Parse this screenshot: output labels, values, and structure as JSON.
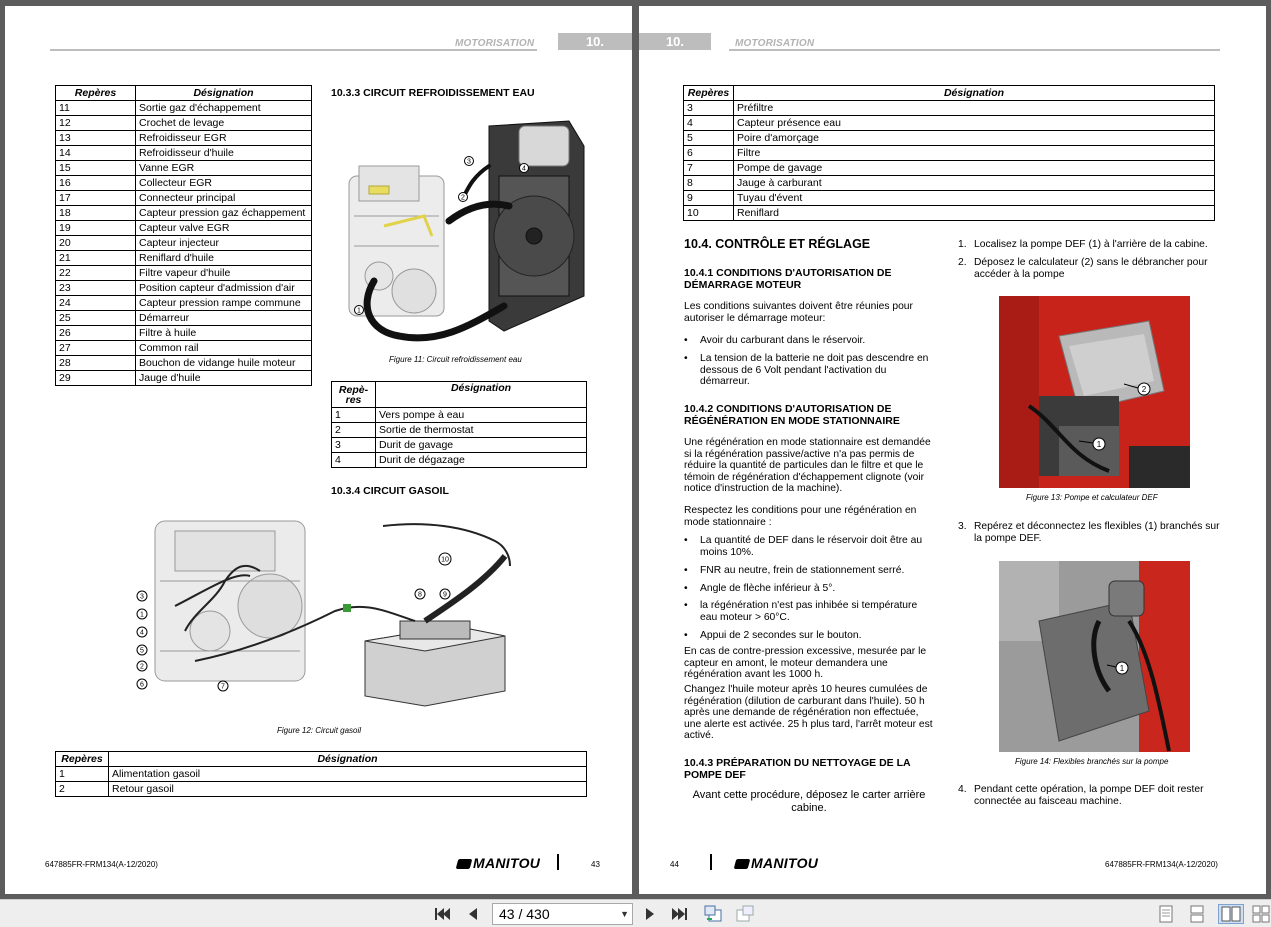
{
  "left_page": {
    "header_title": "MOTORISATION",
    "header_num": "10.",
    "table1": {
      "headers": [
        "Repères",
        "Désignation"
      ],
      "rows": [
        [
          "11",
          "Sortie gaz d'échappement"
        ],
        [
          "12",
          "Crochet de levage"
        ],
        [
          "13",
          "Refroidisseur EGR"
        ],
        [
          "14",
          "Refroidisseur d'huile"
        ],
        [
          "15",
          "Vanne EGR"
        ],
        [
          "16",
          "Collecteur EGR"
        ],
        [
          "17",
          "Connecteur principal"
        ],
        [
          "18",
          "Capteur pression gaz échappement"
        ],
        [
          "19",
          "Capteur valve EGR"
        ],
        [
          "20",
          "Capteur injecteur"
        ],
        [
          "21",
          "Reniflard d'huile"
        ],
        [
          "22",
          "Filtre vapeur d'huile"
        ],
        [
          "23",
          "Position capteur d'admission d'air"
        ],
        [
          "24",
          "Capteur pression rampe commune"
        ],
        [
          "25",
          "Démarreur"
        ],
        [
          "26",
          "Filtre à huile"
        ],
        [
          "27",
          "Common rail"
        ],
        [
          "28",
          "Bouchon de vidange huile moteur"
        ],
        [
          "29",
          "Jauge d'huile"
        ]
      ]
    },
    "section_1033": "10.3.3 CIRCUIT REFROIDISSEMENT EAU",
    "fig11_caption": "Figure 11: Circuit refroidissement eau",
    "fig11_callouts": [
      "1",
      "2",
      "3",
      "4"
    ],
    "table2": {
      "headers": [
        "Repè-res",
        "Désignation"
      ],
      "rows": [
        [
          "1",
          "Vers pompe à eau"
        ],
        [
          "2",
          "Sortie de thermostat"
        ],
        [
          "3",
          "Durit de gavage"
        ],
        [
          "4",
          "Durit de dégazage"
        ]
      ]
    },
    "section_1034": "10.3.4 CIRCUIT GASOIL",
    "fig12_caption": "Figure 12: Circuit gasoil",
    "fig12_callouts": [
      "3",
      "1",
      "4",
      "5",
      "2",
      "6",
      "7",
      "8",
      "9",
      "10"
    ],
    "table3": {
      "headers": [
        "Repères",
        "Désignation"
      ],
      "rows": [
        [
          "1",
          "Alimentation gasoil"
        ],
        [
          "2",
          "Retour gasoil"
        ]
      ]
    },
    "footer_code": "647885FR-FRM134(A-12/2020)",
    "page_number": "43",
    "logo": "MANITOU"
  },
  "right_page": {
    "header_title": "MOTORISATION",
    "header_num": "10.",
    "table1": {
      "headers": [
        "Repères",
        "Désignation"
      ],
      "rows": [
        [
          "3",
          "Préfiltre"
        ],
        [
          "4",
          "Capteur présence eau"
        ],
        [
          "5",
          "Poire d'amorçage"
        ],
        [
          "6",
          "Filtre"
        ],
        [
          "7",
          "Pompe de gavage"
        ],
        [
          "8",
          "Jauge à carburant"
        ],
        [
          "9",
          "Tuyau d'évent"
        ],
        [
          "10",
          "Reniflard"
        ]
      ]
    },
    "section_104": "10.4. CONTRÔLE ET RÉGLAGE",
    "section_1041": "10.4.1 CONDITIONS D'AUTORISATION DE DÉMARRAGE MOTEUR",
    "p_1041": "Les conditions suivantes doivent être réunies pour autoriser le démarrage moteur:",
    "bullets_1041": [
      "Avoir du carburant dans le réservoir.",
      "La tension de la batterie ne doit pas descendre en dessous de 6 Volt pendant l'activation du démarreur."
    ],
    "section_1042": "10.4.2 CONDITIONS D'AUTORISATION DE RÉGÉNÉRATION EN MODE STATIONNAIRE",
    "p_1042a": "Une régénération en mode stationnaire est demandée si la régénération passive/active n'a pas permis de réduire la quantité de particules dan le filtre et que le témoin de régénération d'échappement clignote (voir notice d'instruction de la machine).",
    "p_1042b": "Respectez les conditions pour une régénération en mode stationnaire :",
    "bullets_1042": [
      "La quantité de DEF dans le réservoir doit être au moins 10%.",
      "FNR au neutre, frein de stationnement serré.",
      "Angle de flèche inférieur à 5°.",
      "la régénération n'est pas inhibée si température eau moteur > 60°C.",
      "Appui de 2 secondes sur le bouton."
    ],
    "p_1042c": "En cas de contre-pression excessive, mesurée par le capteur en amont, le moteur demandera une régénération avant les 1000 h.",
    "p_1042d": "Changez l'huile moteur après 10 heures cumulées de régénération (dilution de carburant dans l'huile). 50 h après une demande de régénération non effectuée, une alerte est activée. 25 h plus tard, l'arrêt moteur est activé.",
    "section_1043": "10.4.3 PRÉPARATION DU NETTOYAGE DE LA POMPE DEF",
    "p_1043": "Avant cette procédure, déposez le carter arrière cabine.",
    "steps": [
      {
        "n": "1.",
        "text": "Localisez la pompe DEF (1) à l'arrière de la cabine."
      },
      {
        "n": "2.",
        "text": "Déposez le calculateur (2) sans le débrancher pour accéder à la pompe"
      },
      {
        "n": "3.",
        "text": "Repérez et déconnectez les flexibles (1) branchés sur la pompe DEF."
      },
      {
        "n": "4.",
        "text": "Pendant cette opération, la pompe DEF doit rester connectée au faisceau machine."
      }
    ],
    "fig13_caption": "Figure 13: Pompe et calculateur DEF",
    "fig13_callouts": [
      "2",
      "1"
    ],
    "fig14_caption": "Figure 14: Flexibles branchés sur la pompe",
    "fig14_callouts": [
      "1"
    ],
    "footer_code": "647885FR-FRM134(A-12/2020)",
    "page_number": "44",
    "logo": "MANITOU"
  },
  "toolbar": {
    "current_page": "43",
    "total_pages": "430",
    "page_display": "43 / 430",
    "icons": [
      "first-page-icon",
      "previous-page-icon",
      "next-page-icon",
      "last-page-icon",
      "go-back-view-icon",
      "go-forward-view-icon",
      "single-page-view-icon",
      "continuous-view-icon",
      "facing-view-icon",
      "continuous-facing-view-icon"
    ],
    "active_view": "facing-view-icon"
  }
}
